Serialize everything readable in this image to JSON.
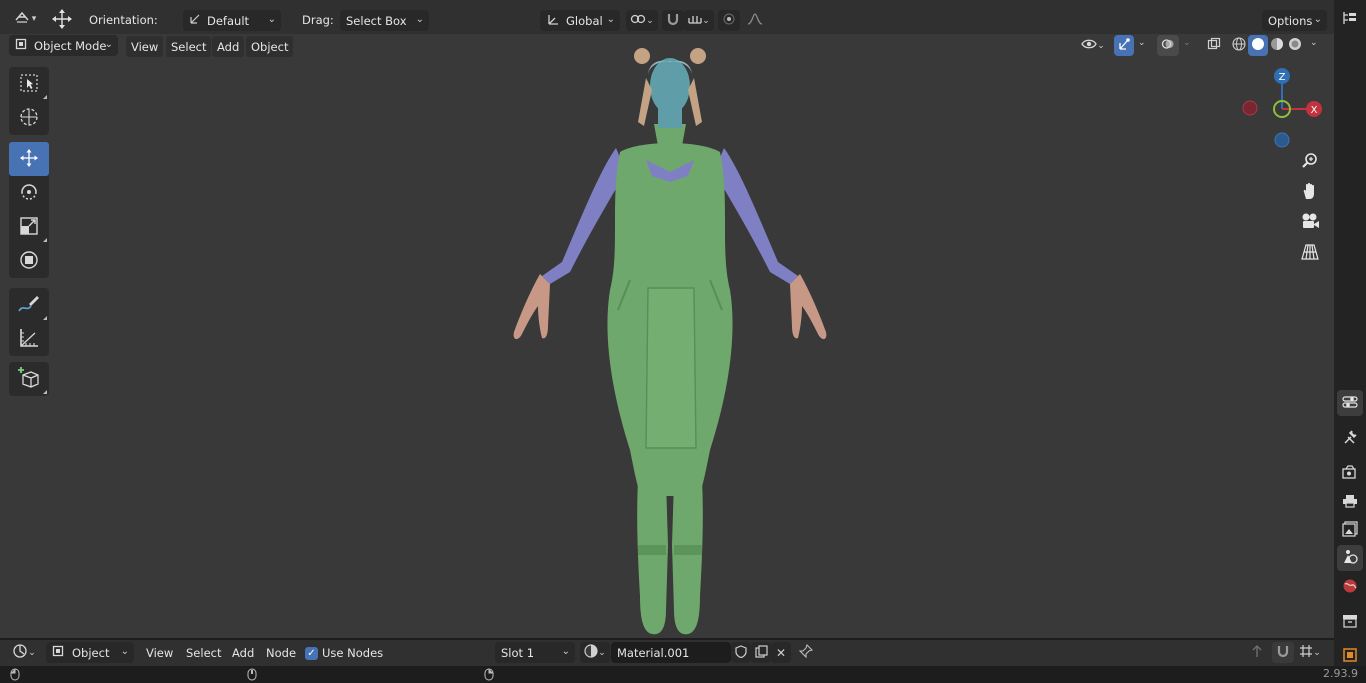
{
  "tool_header": {
    "orientation_label": "Orientation:",
    "orientation_value": "Default",
    "drag_label": "Drag:",
    "drag_value": "Select Box",
    "transform_orientation": "Global",
    "options_label": "Options"
  },
  "viewport_header": {
    "mode": "Object Mode",
    "menus": [
      "View",
      "Select",
      "Add",
      "Object"
    ]
  },
  "gizmo": {
    "z_label": "Z",
    "x_label": "X"
  },
  "node_header": {
    "editor_type": "Object",
    "menus": [
      "View",
      "Select",
      "Add",
      "Node"
    ],
    "use_nodes_label": "Use Nodes",
    "use_nodes_checked": true,
    "slot": "Slot 1",
    "material": "Material.001"
  },
  "status": {
    "version": "2.93.9"
  },
  "colors": {
    "accent": "#4772b3",
    "viewport": "#393939",
    "header": "#303030",
    "dress": "#6fa86c",
    "sleeve": "#7f7fc4",
    "skin_head": "#5f9ea8"
  }
}
